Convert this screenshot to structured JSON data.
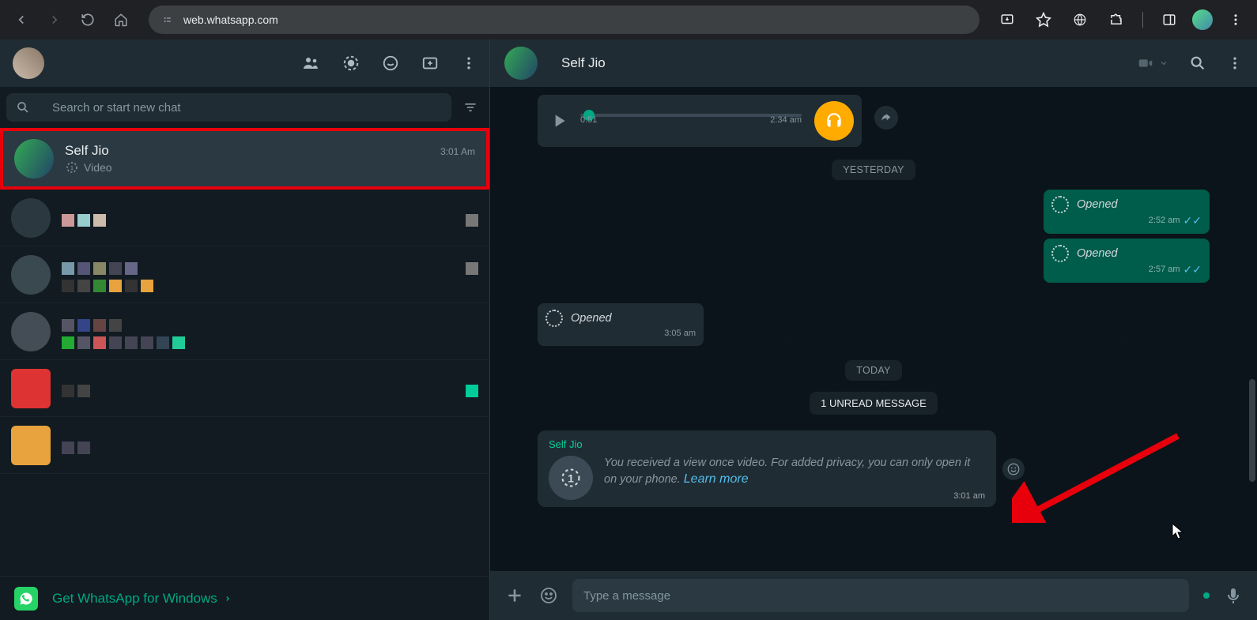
{
  "browser": {
    "url": "web.whatsapp.com"
  },
  "sidebar": {
    "search_placeholder": "Search or start new chat",
    "selected_chat": {
      "name": "Self Jio",
      "time": "3:01 Am",
      "preview": "Video"
    },
    "banner": "Get WhatsApp for Windows"
  },
  "chat": {
    "header_name": "Self Jio",
    "voice": {
      "duration": "0:51",
      "time": "2:34 am"
    },
    "dividers": {
      "yesterday": "YESTERDAY",
      "today": "TODAY"
    },
    "unread": "1 UNREAD MESSAGE",
    "opened_label": "Opened",
    "out1_time": "2:52 am",
    "out2_time": "2:57 am",
    "in1_time": "3:05 am",
    "viewonce": {
      "sender": "Self Jio",
      "text": "You received a view once video. For added privacy, you can only open it on your phone. ",
      "link": "Learn more",
      "time": "3:01 am"
    },
    "composer_placeholder": "Type a message"
  }
}
